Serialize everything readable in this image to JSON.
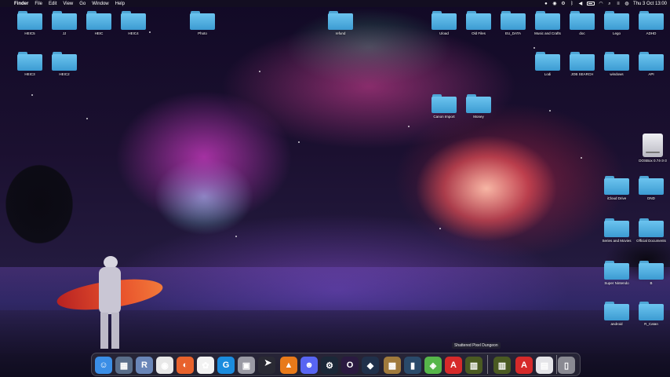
{
  "menubar": {
    "app_name": "Finder",
    "menus": [
      "File",
      "Edit",
      "View",
      "Go",
      "Window",
      "Help"
    ],
    "clock": "Thu 3 Oct  13:00"
  },
  "desktop": {
    "folders": [
      {
        "label": "HEIC5"
      },
      {
        "label": "JJ"
      },
      {
        "label": "HEIC"
      },
      {
        "label": "HEIC4"
      },
      {
        "label": "Photo"
      },
      {
        "label": "refund"
      },
      {
        "label": "Uload"
      },
      {
        "label": "Old Files"
      },
      {
        "label": "EU_DATA"
      },
      {
        "label": "Music and Crafts"
      },
      {
        "label": "doc"
      },
      {
        "label": "Lego"
      },
      {
        "label": "ADHD"
      },
      {
        "label": "HEIC3"
      },
      {
        "label": "HEIC2"
      },
      {
        "label": "Lodi"
      },
      {
        "label": "JOB SEARCH"
      },
      {
        "label": "windows"
      },
      {
        "label": "API"
      },
      {
        "label": "Canon Import"
      },
      {
        "label": "Money"
      },
      {
        "label": "iCloud Drive"
      },
      {
        "label": "DND"
      },
      {
        "label": "Series and Movies"
      },
      {
        "label": "Official Documents"
      },
      {
        "label": "Super Nintendo"
      },
      {
        "label": "B"
      },
      {
        "label": "android"
      },
      {
        "label": "R_Catan"
      }
    ],
    "drive": {
      "label": "DOSBox 0.74-3-3"
    }
  },
  "tooltip": "Shattered Pixel Dungeon",
  "dock": {
    "items": [
      {
        "name": "finder",
        "glyph": "☺",
        "color": "#3a8ee6"
      },
      {
        "name": "photo-preview",
        "glyph": "▦",
        "color": "#5a6e8a"
      },
      {
        "name": "r-app",
        "glyph": "R",
        "color": "#6a86b8"
      },
      {
        "name": "chrome",
        "glyph": "◉",
        "color": "#e8e8e8"
      },
      {
        "name": "firefox",
        "glyph": "◐",
        "color": "#e8622c"
      },
      {
        "name": "photos",
        "glyph": "✿",
        "color": "#f2f2f2"
      },
      {
        "name": "g-hub",
        "glyph": "G",
        "color": "#1b8cde"
      },
      {
        "name": "printer",
        "glyph": "▣",
        "color": "#9a9aa4"
      },
      {
        "name": "pointer-app",
        "glyph": "",
        "color": "#2a2a34"
      },
      {
        "name": "vlc",
        "glyph": "▲",
        "color": "#e87a1a"
      },
      {
        "name": "discord",
        "glyph": "☻",
        "color": "#5865f2"
      },
      {
        "name": "steam",
        "glyph": "⚙",
        "color": "#1b2838"
      },
      {
        "name": "o-app",
        "glyph": "O",
        "color": "#2a1a40"
      },
      {
        "name": "game-app",
        "glyph": "◆",
        "color": "#20304a"
      },
      {
        "name": "dosbox",
        "glyph": "▩",
        "color": "#a07a3c"
      },
      {
        "name": "charts-app",
        "glyph": "▮",
        "color": "#2a4a6a"
      },
      {
        "name": "bluestacks",
        "glyph": "◈",
        "color": "#56b64a"
      },
      {
        "name": "acrobat",
        "glyph": "A",
        "color": "#d62a2a"
      },
      {
        "name": "pixel-dungeon",
        "glyph": "▥",
        "color": "#4a5a22"
      },
      {
        "name": "pixel-dungeon-2",
        "glyph": "▥",
        "color": "#4a5a22"
      },
      {
        "name": "acrobat-2",
        "glyph": "A",
        "color": "#d62a2a"
      },
      {
        "name": "preview-doc",
        "glyph": "▤",
        "color": "#e4e4e8"
      },
      {
        "name": "trash",
        "glyph": "▯",
        "color": "#8a8a92"
      }
    ]
  }
}
